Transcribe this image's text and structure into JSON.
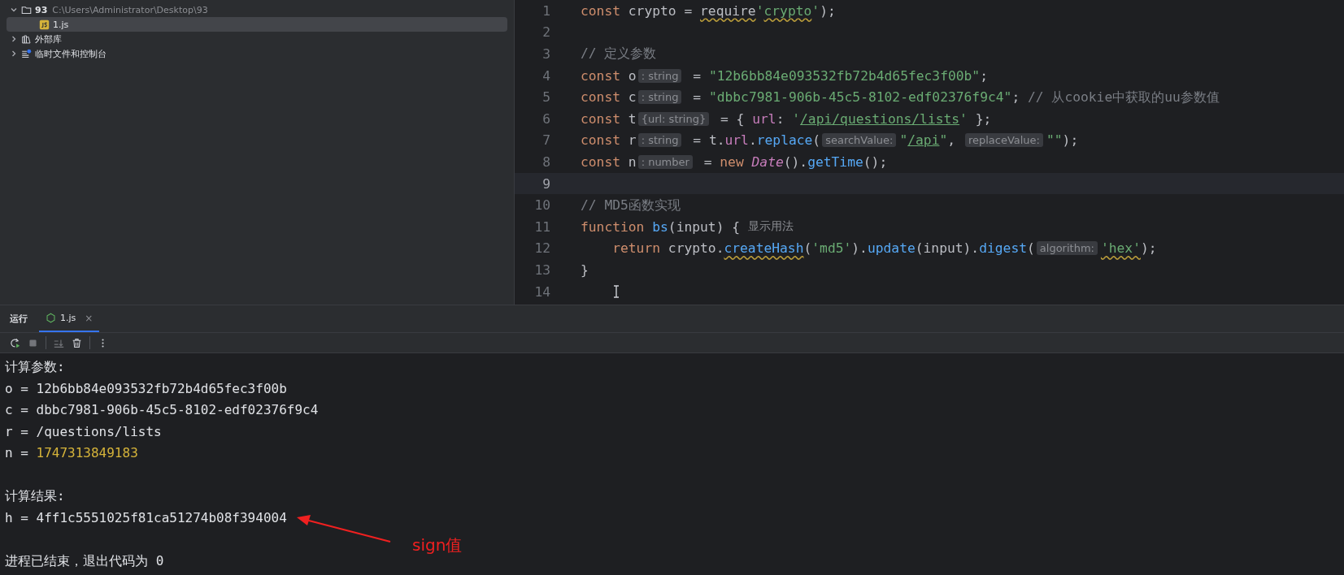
{
  "project_tree": [
    {
      "kind": "folder",
      "label": "93",
      "path": "C:\\Users\\Administrator\\Desktop\\93",
      "expanded": true,
      "selected": false,
      "children": [
        {
          "kind": "js",
          "label": "1.js",
          "selected": true
        }
      ]
    },
    {
      "kind": "library",
      "label": "外部库",
      "expanded": false,
      "selected": false
    },
    {
      "kind": "scratch",
      "label": "临时文件和控制台",
      "expanded": false,
      "selected": false
    }
  ],
  "editor": {
    "lines": [
      {
        "number": "1",
        "current": false,
        "tokens": [
          {
            "kind": "kw",
            "text": "const"
          },
          {
            "kind": "plain",
            "text": " crypto = "
          },
          {
            "kind": "plain",
            "text": "require",
            "squiggly": true
          },
          {
            "kind": "str",
            "text": "'"
          },
          {
            "kind": "str",
            "text": "crypto",
            "squiggly": true
          },
          {
            "kind": "str",
            "text": "'"
          },
          {
            "kind": "plain",
            "text": ");"
          }
        ]
      },
      {
        "number": "2",
        "current": false
      },
      {
        "number": "3",
        "current": false,
        "tokens": [
          {
            "kind": "comment",
            "text": "// 定义参数"
          }
        ]
      },
      {
        "number": "4",
        "current": false,
        "tokens": [
          {
            "kind": "kw",
            "text": "const"
          },
          {
            "kind": "plain",
            "text": " o"
          },
          {
            "kind": "hint",
            "text": ": string"
          },
          {
            "kind": "plain",
            "text": " = "
          },
          {
            "kind": "str",
            "text": "\"12b6bb84e093532fb72b4d65fec3f00b\""
          },
          {
            "kind": "plain",
            "text": ";"
          }
        ]
      },
      {
        "number": "5",
        "current": false,
        "tokens": [
          {
            "kind": "kw",
            "text": "const"
          },
          {
            "kind": "plain",
            "text": " c"
          },
          {
            "kind": "hint",
            "text": ": string"
          },
          {
            "kind": "plain",
            "text": " = "
          },
          {
            "kind": "str",
            "text": "\"dbbc7981-906b-45c5-8102-edf02376f9c4\""
          },
          {
            "kind": "plain",
            "text": "; "
          },
          {
            "kind": "comment",
            "text": "// 从cookie中获取的uu参数值"
          }
        ]
      },
      {
        "number": "6",
        "current": false,
        "tokens": [
          {
            "kind": "kw",
            "text": "const"
          },
          {
            "kind": "plain",
            "text": " t"
          },
          {
            "kind": "hint",
            "text": "{url: string}"
          },
          {
            "kind": "plain",
            "text": " = { "
          },
          {
            "kind": "prop",
            "text": "url"
          },
          {
            "kind": "plain",
            "text": ": "
          },
          {
            "kind": "str",
            "text": "'"
          },
          {
            "kind": "link",
            "text": "/api/questions/lists"
          },
          {
            "kind": "str",
            "text": "'"
          },
          {
            "kind": "plain",
            "text": " };"
          }
        ]
      },
      {
        "number": "7",
        "current": false,
        "tokens": [
          {
            "kind": "kw",
            "text": "const"
          },
          {
            "kind": "plain",
            "text": " r"
          },
          {
            "kind": "hint",
            "text": ": string"
          },
          {
            "kind": "plain",
            "text": " = t."
          },
          {
            "kind": "prop",
            "text": "url"
          },
          {
            "kind": "plain",
            "text": "."
          },
          {
            "kind": "fn",
            "text": "replace"
          },
          {
            "kind": "plain",
            "text": "("
          },
          {
            "kind": "hint",
            "text": "searchValue:"
          },
          {
            "kind": "str",
            "text": "\""
          },
          {
            "kind": "link",
            "text": "/api"
          },
          {
            "kind": "str",
            "text": "\""
          },
          {
            "kind": "plain",
            "text": ", "
          },
          {
            "kind": "hint",
            "text": "replaceValue:"
          },
          {
            "kind": "str",
            "text": "\"\""
          },
          {
            "kind": "plain",
            "text": ");"
          }
        ]
      },
      {
        "number": "8",
        "current": false,
        "tokens": [
          {
            "kind": "kw",
            "text": "const"
          },
          {
            "kind": "plain",
            "text": " n"
          },
          {
            "kind": "hint",
            "text": ": number"
          },
          {
            "kind": "plain",
            "text": " = "
          },
          {
            "kind": "kw",
            "text": "new"
          },
          {
            "kind": "cls",
            "text": " Date"
          },
          {
            "kind": "plain",
            "text": "()."
          },
          {
            "kind": "fn",
            "text": "getTime"
          },
          {
            "kind": "plain",
            "text": "();"
          }
        ]
      },
      {
        "number": "9",
        "current": true
      },
      {
        "number": "10",
        "current": false,
        "tokens": [
          {
            "kind": "comment",
            "text": "// MD5函数实现"
          }
        ]
      },
      {
        "number": "11",
        "current": false,
        "tokens": [
          {
            "kind": "kw",
            "text": "function"
          },
          {
            "kind": "fn",
            "text": " bs"
          },
          {
            "kind": "plain",
            "text": "(input) {"
          },
          {
            "kind": "usage",
            "text": "显示用法"
          }
        ]
      },
      {
        "number": "12",
        "current": false,
        "tokens": [
          {
            "kind": "kw",
            "text": "    return"
          },
          {
            "kind": "plain",
            "text": " crypto."
          },
          {
            "kind": "fn",
            "text": "createHash",
            "squiggly": true
          },
          {
            "kind": "plain",
            "text": "("
          },
          {
            "kind": "str",
            "text": "'md5'"
          },
          {
            "kind": "plain",
            "text": ")."
          },
          {
            "kind": "fn",
            "text": "update"
          },
          {
            "kind": "plain",
            "text": "(input)."
          },
          {
            "kind": "fn",
            "text": "digest"
          },
          {
            "kind": "plain",
            "text": "("
          },
          {
            "kind": "hint",
            "text": "algorithm:"
          },
          {
            "kind": "str",
            "text": "'hex'",
            "squiggly": true
          },
          {
            "kind": "plain",
            "text": ");"
          }
        ]
      },
      {
        "number": "13",
        "current": false,
        "tokens": [
          {
            "kind": "plain",
            "text": "}"
          }
        ]
      },
      {
        "number": "14",
        "current": false,
        "text_cursor": true
      }
    ]
  },
  "run_panel": {
    "title": "运行",
    "tabs": [
      {
        "label": "1.js",
        "selected": true,
        "close": "×"
      }
    ],
    "toolbar": [
      {
        "kind": "rerun",
        "disabled": false
      },
      {
        "kind": "stop",
        "disabled": true
      },
      {
        "kind": "separator"
      },
      {
        "kind": "scroll-end",
        "disabled": true
      },
      {
        "kind": "trash",
        "disabled": false
      },
      {
        "kind": "separator"
      },
      {
        "kind": "more",
        "disabled": false
      }
    ],
    "console": [
      {
        "space_before": false,
        "parts": [
          {
            "kind": "plain",
            "text": "计算参数:"
          }
        ]
      },
      {
        "space_before": false,
        "parts": [
          {
            "kind": "plain",
            "text": "o = 12b6bb84e093532fb72b4d65fec3f00b"
          }
        ]
      },
      {
        "space_before": false,
        "parts": [
          {
            "kind": "plain",
            "text": "c = dbbc7981-906b-45c5-8102-edf02376f9c4"
          }
        ]
      },
      {
        "space_before": false,
        "parts": [
          {
            "kind": "plain",
            "text": "r = /questions/lists"
          }
        ]
      },
      {
        "space_before": false,
        "parts": [
          {
            "kind": "plain",
            "text": "n = "
          },
          {
            "kind": "number",
            "text": "1747313849183"
          }
        ]
      },
      {
        "space_before": true,
        "parts": [
          {
            "kind": "plain",
            "text": "计算结果:"
          }
        ]
      },
      {
        "space_before": false,
        "parts": [
          {
            "kind": "plain",
            "text": "h = 4ff1c5551025f81ca51274b08f394004"
          }
        ]
      },
      {
        "space_before": true,
        "parts": [
          {
            "kind": "plain",
            "text": "进程已结束，退出代码为 0"
          }
        ]
      }
    ],
    "annotation": {
      "text": "sign值"
    }
  }
}
